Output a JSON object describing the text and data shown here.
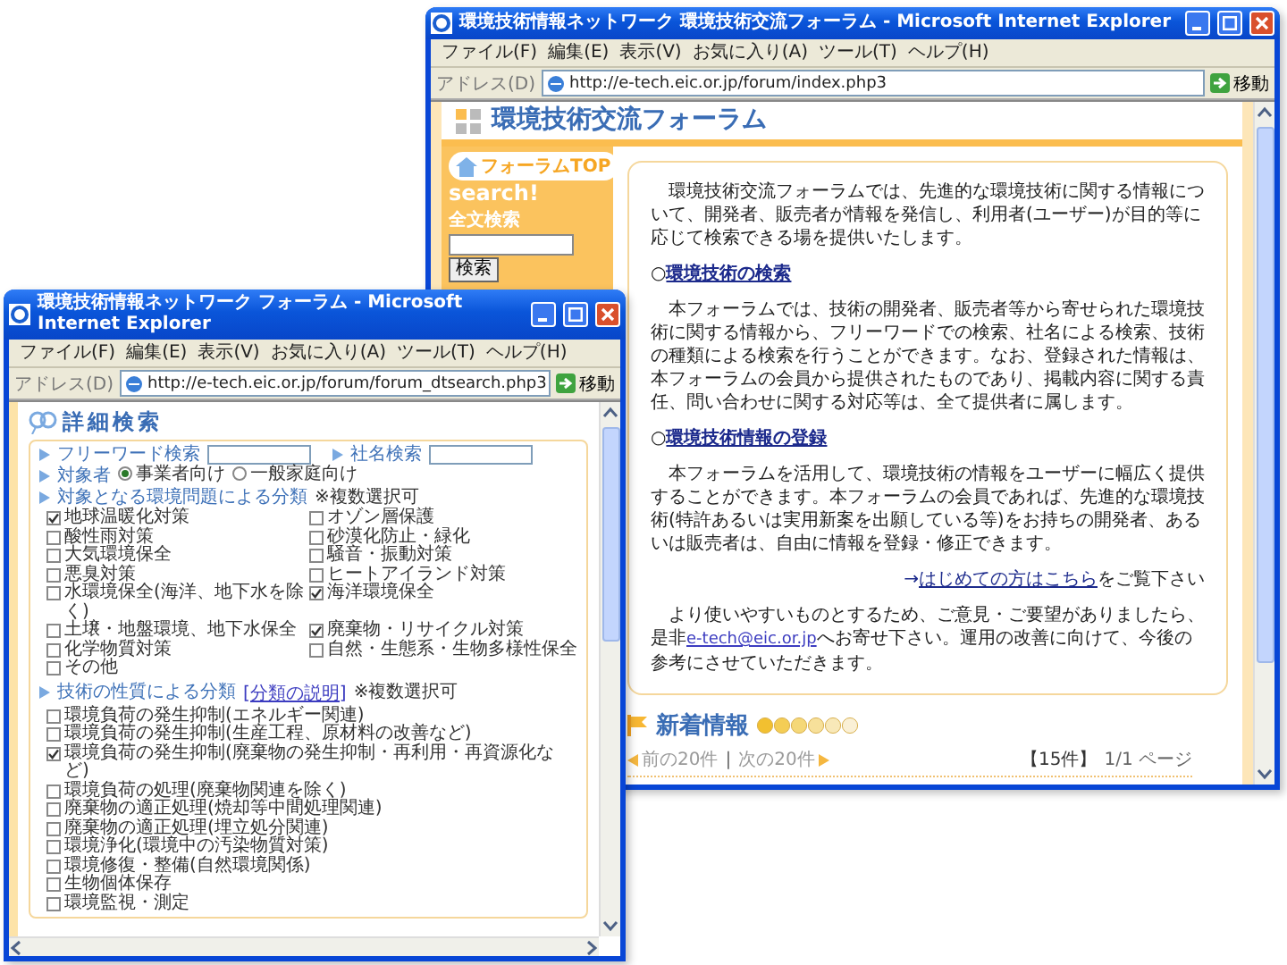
{
  "main_window": {
    "title": "環境技術情報ネットワーク 環境技術交流フォーラム - Microsoft Internet Explorer",
    "menu": [
      "ファイル(F)",
      "編集(E)",
      "表示(V)",
      "お気に入り(A)",
      "ツール(T)",
      "ヘルプ(H)"
    ],
    "address": {
      "label": "アドレス(D)",
      "url": "http://e-tech.eic.or.jp/forum/index.php3",
      "go": "移動"
    },
    "banner": "環境技術交流フォーラム",
    "sidebar": {
      "top_button": "フォーラムTOP",
      "search_title": "search!",
      "fulltext_label": "全文検索",
      "search_button": "検索"
    },
    "content": [
      {
        "kind": "paragraph",
        "text": "環境技術交流フォーラムでは、先進的な環境技術に関する情報について、開発者、販売者が情報を発信し、利用者(ユーザー)が目的等に応じて検索できる場を提供いたします。"
      },
      {
        "kind": "heading",
        "marker": "○",
        "link": "環境技術の検索"
      },
      {
        "kind": "paragraph",
        "text": "本フォーラムでは、技術の開発者、販売者等から寄せられた環境技術に関する情報から、フリーワードでの検索、社名による検索、技術の種類による検索を行うことができます。なお、登録された情報は、本フォーラムの会員から提供されたものであり、掲載内容に関する責任、問い合わせに関する対応等は、全て提供者に属します。"
      },
      {
        "kind": "heading",
        "marker": "○",
        "link": "環境技術情報の登録"
      },
      {
        "kind": "paragraph",
        "text": "本フォーラムを活用して、環境技術の情報をユーザーに幅広く提供することができます。本フォーラムの会員であれば、先進的な環境技術(特許あるいは実用新案を出願している等)をお持ちの開発者、あるいは販売者は、自由に情報を登録・修正できます。"
      },
      {
        "kind": "guide",
        "before": "→",
        "link": "はじめての方はこちら",
        "after": "をご覧下さい"
      },
      {
        "kind": "contact",
        "before": "より使いやすいものとするため、ご意見・ご要望がありましたら、是非",
        "link": "e-tech@eic.or.jp",
        "after": "へお寄せ下さい。運用の改善に向けて、今後の参考にさせていただきます。"
      }
    ],
    "news": {
      "title": "新着情報",
      "prev": "前の20件",
      "separator": "|",
      "next": "次の20件",
      "count": "【15件】",
      "page": "1/1 ページ"
    }
  },
  "search_window": {
    "title": "環境技術情報ネットワーク フォーラム - Microsoft Internet Explorer",
    "menu": [
      "ファイル(F)",
      "編集(E)",
      "表示(V)",
      "お気に入り(A)",
      "ツール(T)",
      "ヘルプ(H)"
    ],
    "address": {
      "label": "アドレス(D)",
      "url": "http://e-tech.eic.or.jp/forum/forum_dtsearch.php3",
      "go": "移動"
    },
    "heading": "詳細検索",
    "fields": [
      {
        "label": "フリーワード検索"
      },
      {
        "label": "社名検索"
      }
    ],
    "audience": {
      "label": "対象者",
      "options": [
        {
          "label": "事業者向け",
          "selected": true
        },
        {
          "label": "一般家庭向け",
          "selected": false
        }
      ]
    },
    "categories": {
      "title": "対象となる環境問題による分類",
      "note": "※複数選択可",
      "items": [
        {
          "label": "地球温暖化対策",
          "checked": true
        },
        {
          "label": "オゾン層保護",
          "checked": false
        },
        {
          "label": "酸性雨対策",
          "checked": false
        },
        {
          "label": "砂漠化防止・緑化",
          "checked": false
        },
        {
          "label": "大気環境保全",
          "checked": false
        },
        {
          "label": "騒音・振動対策",
          "checked": false
        },
        {
          "label": "悪臭対策",
          "checked": false
        },
        {
          "label": "ヒートアイランド対策",
          "checked": false
        },
        {
          "label": "水環境保全(海洋、地下水を除く)",
          "checked": false
        },
        {
          "label": "海洋環境保全",
          "checked": true
        },
        {
          "label": "土壌・地盤環境、地下水保全",
          "checked": false
        },
        {
          "label": "廃棄物・リサイクル対策",
          "checked": true
        },
        {
          "label": "化学物質対策",
          "checked": false
        },
        {
          "label": "自然・生態系・生物多様性保全",
          "checked": false
        },
        {
          "label": "その他",
          "checked": false
        }
      ]
    },
    "techniques": {
      "title": "技術の性質による分類",
      "link": "[分類の説明]",
      "note": "※複数選択可",
      "items": [
        {
          "label": "環境負荷の発生抑制(エネルギー関連)",
          "checked": false
        },
        {
          "label": "環境負荷の発生抑制(生産工程、原材料の改善など)",
          "checked": false
        },
        {
          "label": "環境負荷の発生抑制(廃棄物の発生抑制・再利用・再資源化など)",
          "checked": true
        },
        {
          "label": "環境負荷の処理(廃棄物関連を除く)",
          "checked": false
        },
        {
          "label": "廃棄物の適正処理(焼却等中間処理関連)",
          "checked": false
        },
        {
          "label": "廃棄物の適正処理(埋立処分関連)",
          "checked": false
        },
        {
          "label": "環境浄化(環境中の汚染物質対策)",
          "checked": false
        },
        {
          "label": "環境修復・整備(自然環境関係)",
          "checked": false
        },
        {
          "label": "生物個体保存",
          "checked": false
        },
        {
          "label": "環境監視・測定",
          "checked": false
        }
      ]
    }
  }
}
